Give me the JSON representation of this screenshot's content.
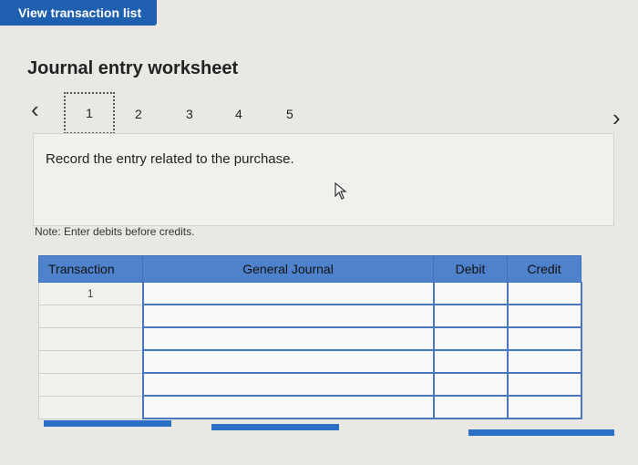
{
  "header": {
    "view_list_label": "View transaction list"
  },
  "page": {
    "title": "Journal entry worksheet"
  },
  "steps": {
    "items": [
      "1",
      "2",
      "3",
      "4",
      "5"
    ],
    "active": "1"
  },
  "instruction": {
    "text": "Record the entry related to the purchase."
  },
  "note": {
    "text": "Note: Enter debits before credits."
  },
  "table": {
    "headers": {
      "transaction": "Transaction",
      "general_journal": "General Journal",
      "debit": "Debit",
      "credit": "Credit"
    },
    "rows": [
      {
        "transaction": "1"
      },
      {
        "transaction": ""
      },
      {
        "transaction": ""
      },
      {
        "transaction": ""
      },
      {
        "transaction": ""
      },
      {
        "transaction": ""
      }
    ]
  },
  "icons": {
    "prev": "chevron-left-icon",
    "next": "chevron-right-icon",
    "cursor": "mouse-cursor-icon"
  },
  "colors": {
    "header_button": "#1f5fb0",
    "table_header": "#4f82cc",
    "action_bar": "#2c6fc6"
  }
}
